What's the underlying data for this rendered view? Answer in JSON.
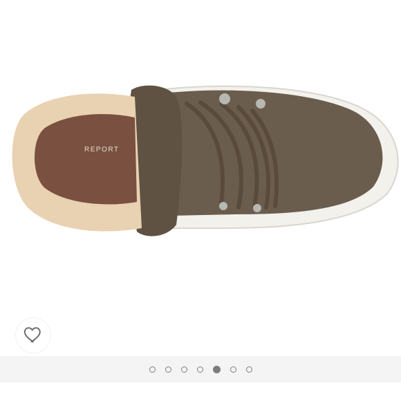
{
  "product": {
    "insole_brand": "REPORT",
    "colors": {
      "upper": "#6b5d4d",
      "sherpa": "#e9d2b1",
      "sole": "#f3f1ec",
      "insole": "#7a5140",
      "lace": "#5a4a3c",
      "hardware": "#b8b7b2"
    }
  },
  "actions": {
    "like_icon": "heart-icon"
  },
  "carousel": {
    "total": 7,
    "active_index": 4
  },
  "theme": {
    "dot_color": "#7d7d7d",
    "bar_background": "#f4f4f4"
  }
}
